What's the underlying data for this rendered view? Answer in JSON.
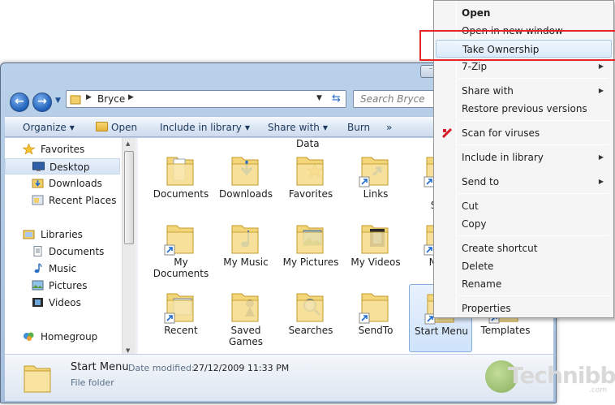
{
  "window": {
    "title_btn": "⁻",
    "address": {
      "crumb": "Bryce"
    },
    "search_placeholder": "Search Bryce"
  },
  "toolbar": {
    "organize": "Organize",
    "open": "Open",
    "include_in_library": "Include in library",
    "share_with": "Share with",
    "burn": "Burn",
    "more": "»"
  },
  "nav_pane": {
    "favorites_header": "Favorites",
    "favorites": [
      "Desktop",
      "Downloads",
      "Recent Places"
    ],
    "libraries_header": "Libraries",
    "libraries": [
      "Documents",
      "Music",
      "Pictures",
      "Videos"
    ],
    "homegroup": "Homegroup"
  },
  "files": {
    "partial_top_label": "Data",
    "items": [
      {
        "label": "Documents",
        "type": "docs"
      },
      {
        "label": "Downloads",
        "type": "downloads"
      },
      {
        "label": "Favorites",
        "type": "favorites"
      },
      {
        "label": "Links",
        "type": "links"
      },
      {
        "label": "Lo\nSett",
        "type": "shortcut"
      },
      {
        "label": "My\nDocuments",
        "type": "shortcut"
      },
      {
        "label": "My Music",
        "type": "music"
      },
      {
        "label": "My Pictures",
        "type": "pictures"
      },
      {
        "label": "My Videos",
        "type": "videos"
      },
      {
        "label": "Neth",
        "type": "shortcut"
      },
      {
        "label": "Recent",
        "type": "recent"
      },
      {
        "label": "Saved\nGames",
        "type": "games"
      },
      {
        "label": "Searches",
        "type": "searches"
      },
      {
        "label": "SendTo",
        "type": "shortcut"
      },
      {
        "label": "Start Menu",
        "type": "shortcut"
      },
      {
        "label": "Templates",
        "type": "shortcut"
      }
    ]
  },
  "details": {
    "name": "Start Menu",
    "date_modified_label": "Date modified:",
    "date_modified": "27/12/2009 11:33 PM",
    "type": "File folder"
  },
  "context_menu": {
    "items": [
      {
        "label": "Open",
        "bold": true
      },
      {
        "label": "Open in new window"
      },
      {
        "label": "Take Ownership",
        "highlighted": true
      },
      {
        "label": "7-Zip",
        "submenu": true
      },
      {
        "label": "Share with",
        "submenu": true
      },
      {
        "label": "Restore previous versions"
      },
      {
        "label": "Scan for viruses"
      },
      {
        "label": "Include in library",
        "submenu": true
      },
      {
        "label": "Send to",
        "submenu": true
      },
      {
        "label": "Cut"
      },
      {
        "label": "Copy"
      },
      {
        "label": "Create shortcut"
      },
      {
        "label": "Delete"
      },
      {
        "label": "Rename"
      },
      {
        "label": "Properties"
      }
    ]
  },
  "watermark": {
    "text": "Technibble",
    "com": ".com"
  },
  "colors": {
    "callout": "#e2262a",
    "selection": "#cfe3fb"
  }
}
